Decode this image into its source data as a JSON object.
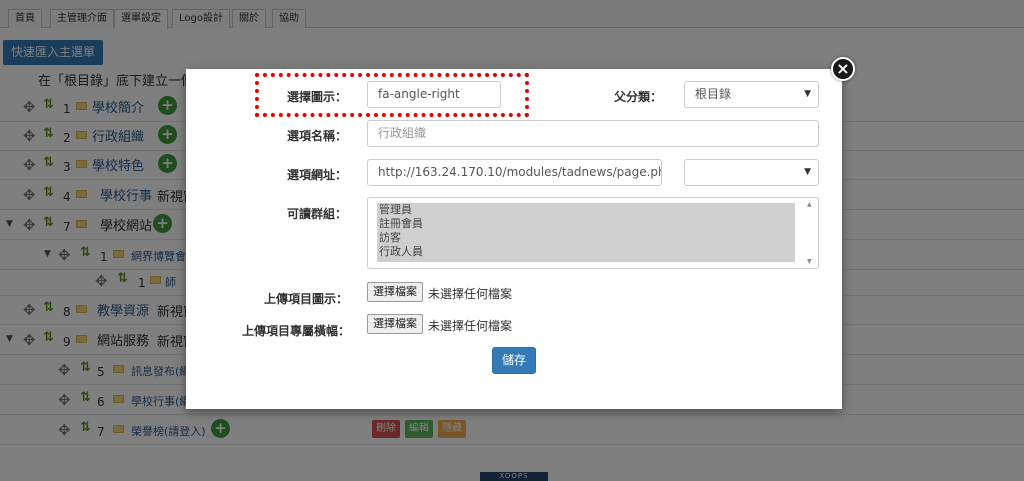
{
  "tabs": [
    {
      "label": "首頁"
    },
    {
      "label": "主管理介面"
    },
    {
      "label": "選單設定"
    },
    {
      "label": "Logo設計"
    },
    {
      "label": "關於"
    },
    {
      "label": "協助"
    }
  ],
  "quick_import_label": "快速匯入主選單",
  "tree_hint": "在「根目錄」底下建立一個",
  "tree": [
    {
      "num": "1",
      "title": "學校簡介"
    },
    {
      "num": "2",
      "title": "行政組織"
    },
    {
      "num": "3",
      "title": "學校特色"
    },
    {
      "num": "4",
      "title": "學校行事",
      "extra": "新視窗"
    },
    {
      "num": "7",
      "title": "學校網站",
      "extra": "新視窗"
    },
    {
      "num": "1",
      "title": "網界博覽會"
    },
    {
      "num": "1",
      "title": "師"
    },
    {
      "num": "8",
      "title": "教學資源",
      "extra": "新視窗"
    },
    {
      "num": "9",
      "title": "網站服務",
      "extra": "新視窗"
    },
    {
      "num": "5",
      "title": "訊息發布(網"
    },
    {
      "num": "6",
      "title": "學校行事(網"
    },
    {
      "num": "7",
      "title": "榮譽榜(請登入)"
    }
  ],
  "row_actions": {
    "delete": "刪除",
    "edit": "編輯",
    "hide": "隱藏"
  },
  "footer_logo": "XOOPS",
  "modal": {
    "icon_label": "選擇圖示：",
    "icon_value": "fa-angle-right",
    "parent_label": "父分類：",
    "parent_value": "根目錄",
    "name_label": "選項名稱：",
    "name_placeholder": "行政組織",
    "url_label": "選項網址：",
    "url_value": "http://163.24.170.10/modules/tadnews/page.php?ncsn=",
    "target_value": "",
    "groups_label": "可讀群組：",
    "groups": [
      "管理員",
      "註冊會員",
      "訪客",
      "行政人員"
    ],
    "upload_icon_label": "上傳項目圖示：",
    "upload_banner_label": "上傳項目專屬橫幅：",
    "choose_file_label": "選擇檔案",
    "no_file_label": "未選擇任何檔案",
    "save_label": "儲存",
    "close_glyph": "×"
  }
}
